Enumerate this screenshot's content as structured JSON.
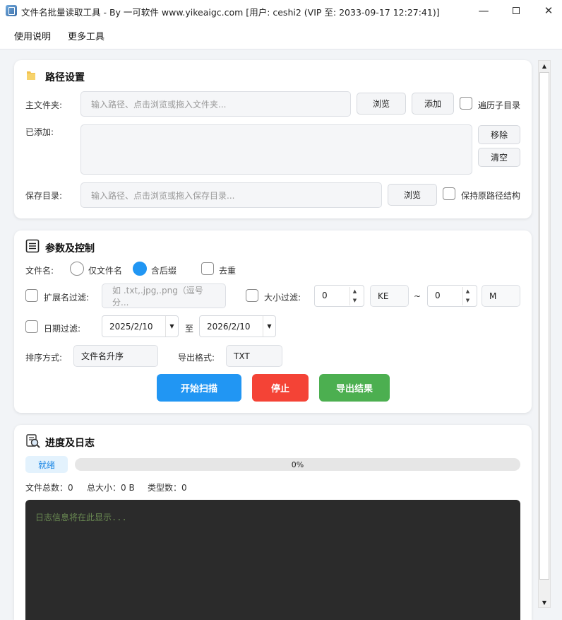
{
  "window": {
    "title": "文件名批量读取工具 - By 一可软件 www.yikeaigc.com [用户: ceshi2 (VIP 至: 2033-09-17 12:27:41)]",
    "minimize": "—",
    "close": "✕"
  },
  "menu": {
    "items": [
      "使用说明",
      "更多工具"
    ]
  },
  "path_section": {
    "title": "路径设置",
    "icon": "folder-icon",
    "main_folder_label": "主文件夹:",
    "main_folder_placeholder": "输入路径、点击浏览或拖入文件夹...",
    "browse_label": "浏览",
    "add_label": "添加",
    "traverse_subdirs_label": "遍历子目录",
    "traverse_subdirs_checked": false,
    "added_label": "已添加:",
    "remove_label": "移除",
    "clear_label": "清空",
    "save_dir_label": "保存目录:",
    "save_dir_placeholder": "输入路径、点击浏览或拖入保存目录...",
    "save_browse_label": "浏览",
    "keep_structure_label": "保持原路径结构",
    "keep_structure_checked": false
  },
  "params_section": {
    "title": "参数及控制",
    "icon": "list-icon",
    "filename_label": "文件名:",
    "name_only_label": "仅文件名",
    "with_ext_label": "含后缀",
    "selected_filename_mode": "含后缀",
    "dedupe_label": "去重",
    "ext_filter_label": "扩展名过滤:",
    "ext_filter_placeholder": "如 .txt,.jpg,.png（逗号分...",
    "size_filter_label": "大小过滤:",
    "size_min": "0",
    "size_min_unit": "KE",
    "size_separator": "~",
    "size_max": "0",
    "size_max_unit": "M",
    "date_filter_label": "日期过滤:",
    "date_start": "2025/2/10",
    "date_to_label": "至",
    "date_end": "2026/2/10",
    "sort_label": "排序方式:",
    "sort_value": "文件名升序",
    "export_format_label": "导出格式:",
    "export_format_value": "TXT",
    "start_scan_label": "开始扫描",
    "stop_label": "停止",
    "export_result_label": "导出结果",
    "colors": {
      "start": "#2196f3",
      "stop": "#f44336",
      "export": "#4caf50"
    }
  },
  "log_section": {
    "title": "进度及日志",
    "icon": "log-search-icon",
    "status": "就绪",
    "progress_value": 0,
    "progress_text": "0%",
    "total_files_text": "文件总数：0",
    "total_size_text": "总大小：0 B",
    "types_text": "类型数：0",
    "log_placeholder": "日志信息将在此显示..."
  },
  "scrollbar": {
    "up": "▲",
    "down": "▼"
  }
}
